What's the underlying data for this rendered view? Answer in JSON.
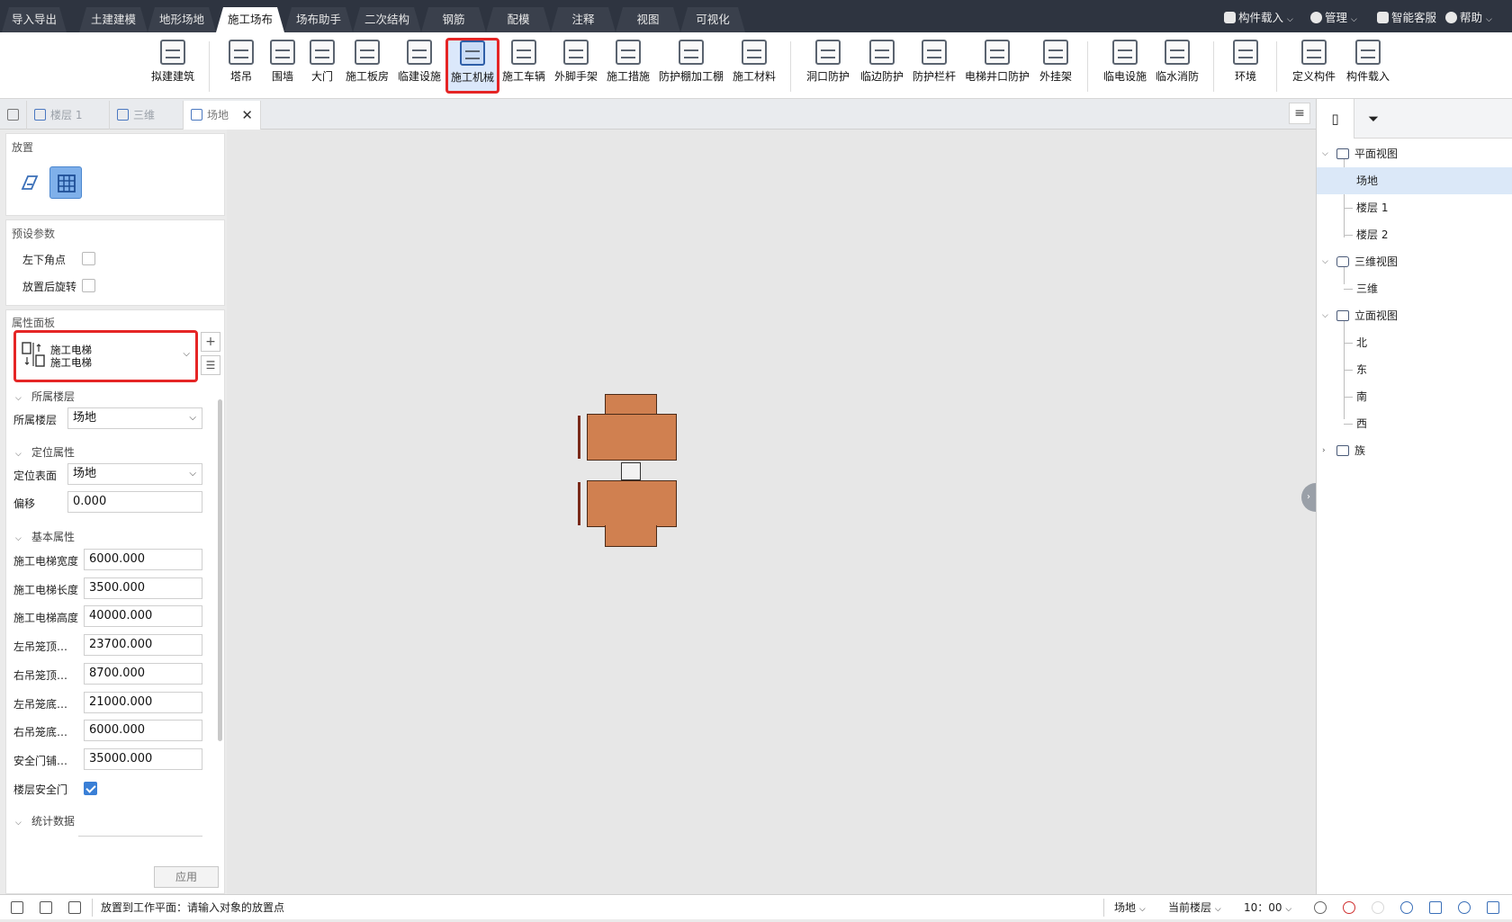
{
  "menu_tabs": [
    "导入导出",
    "土建建模",
    "地形场地",
    "施工场布",
    "场布助手",
    "二次结构",
    "钢筋",
    "配模",
    "注释",
    "视图",
    "可视化"
  ],
  "menu_active": "施工场布",
  "top_right": {
    "component_load": "构件载入",
    "manage": "管理",
    "service": "智能客服",
    "help": "帮助"
  },
  "ribbon": [
    "拟建建筑",
    "塔吊",
    "围墙",
    "大门",
    "施工板房",
    "临建设施",
    "施工机械",
    "施工车辆",
    "外脚手架",
    "施工措施",
    "防护棚加工棚",
    "施工材料",
    "洞口防护",
    "临边防护",
    "防护栏杆",
    "电梯井口防护",
    "外挂架",
    "临电设施",
    "临水消防",
    "环境",
    "定义构件",
    "构件载入"
  ],
  "ribbon_selected": "施工机械",
  "doc_tabs": [
    "楼层 1",
    "三维",
    "场地"
  ],
  "doc_active": "场地",
  "left": {
    "place_title": "放置",
    "preset_title": "预设参数",
    "preset_items": [
      {
        "label": "左下角点",
        "checked": false
      },
      {
        "label": "放置后旋转",
        "checked": false
      }
    ],
    "prop_title": "属性面板",
    "type_line1": "施工电梯",
    "type_line2": "施工电梯",
    "group_floor": "所属楼层",
    "floor_label": "所属楼层",
    "floor_value": "场地",
    "group_position": "定位属性",
    "surface_label": "定位表面",
    "surface_value": "场地",
    "offset_label": "偏移",
    "offset_value": "0.000",
    "group_basic": "基本属性",
    "props": [
      {
        "label": "施工电梯宽度",
        "value": "6000.000"
      },
      {
        "label": "施工电梯长度",
        "value": "3500.000"
      },
      {
        "label": "施工电梯高度",
        "value": "40000.000"
      },
      {
        "label": "左吊笼顶…",
        "value": "23700.000"
      },
      {
        "label": "右吊笼顶…",
        "value": "8700.000"
      },
      {
        "label": "左吊笼底…",
        "value": "21000.000"
      },
      {
        "label": "右吊笼底…",
        "value": "6000.000"
      },
      {
        "label": "安全门铺…",
        "value": "35000.000"
      }
    ],
    "floor_door_label": "楼层安全门",
    "floor_door_checked": true,
    "group_stats": "统计数据",
    "apply": "应用"
  },
  "tree": [
    {
      "label": "平面视图",
      "level": 0,
      "expanded": true
    },
    {
      "label": "场地",
      "level": 1,
      "selected": true
    },
    {
      "label": "楼层 1",
      "level": 1
    },
    {
      "label": "楼层 2",
      "level": 1
    },
    {
      "label": "三维视图",
      "level": 0,
      "expanded": true
    },
    {
      "label": "三维",
      "level": 1
    },
    {
      "label": "立面视图",
      "level": 0,
      "expanded": true
    },
    {
      "label": "北",
      "level": 1
    },
    {
      "label": "东",
      "level": 1
    },
    {
      "label": "南",
      "level": 1
    },
    {
      "label": "西",
      "level": 1
    },
    {
      "label": "族",
      "level": 0,
      "expanded": false
    }
  ],
  "status": {
    "message": "放置到工作平面：请输入对象的放置点",
    "scope": "场地",
    "floor": "当前楼层",
    "time": "10：00"
  },
  "colors": {
    "accent": "#3a7fd6",
    "highlight": "#e52525",
    "machine": "#d08050"
  }
}
